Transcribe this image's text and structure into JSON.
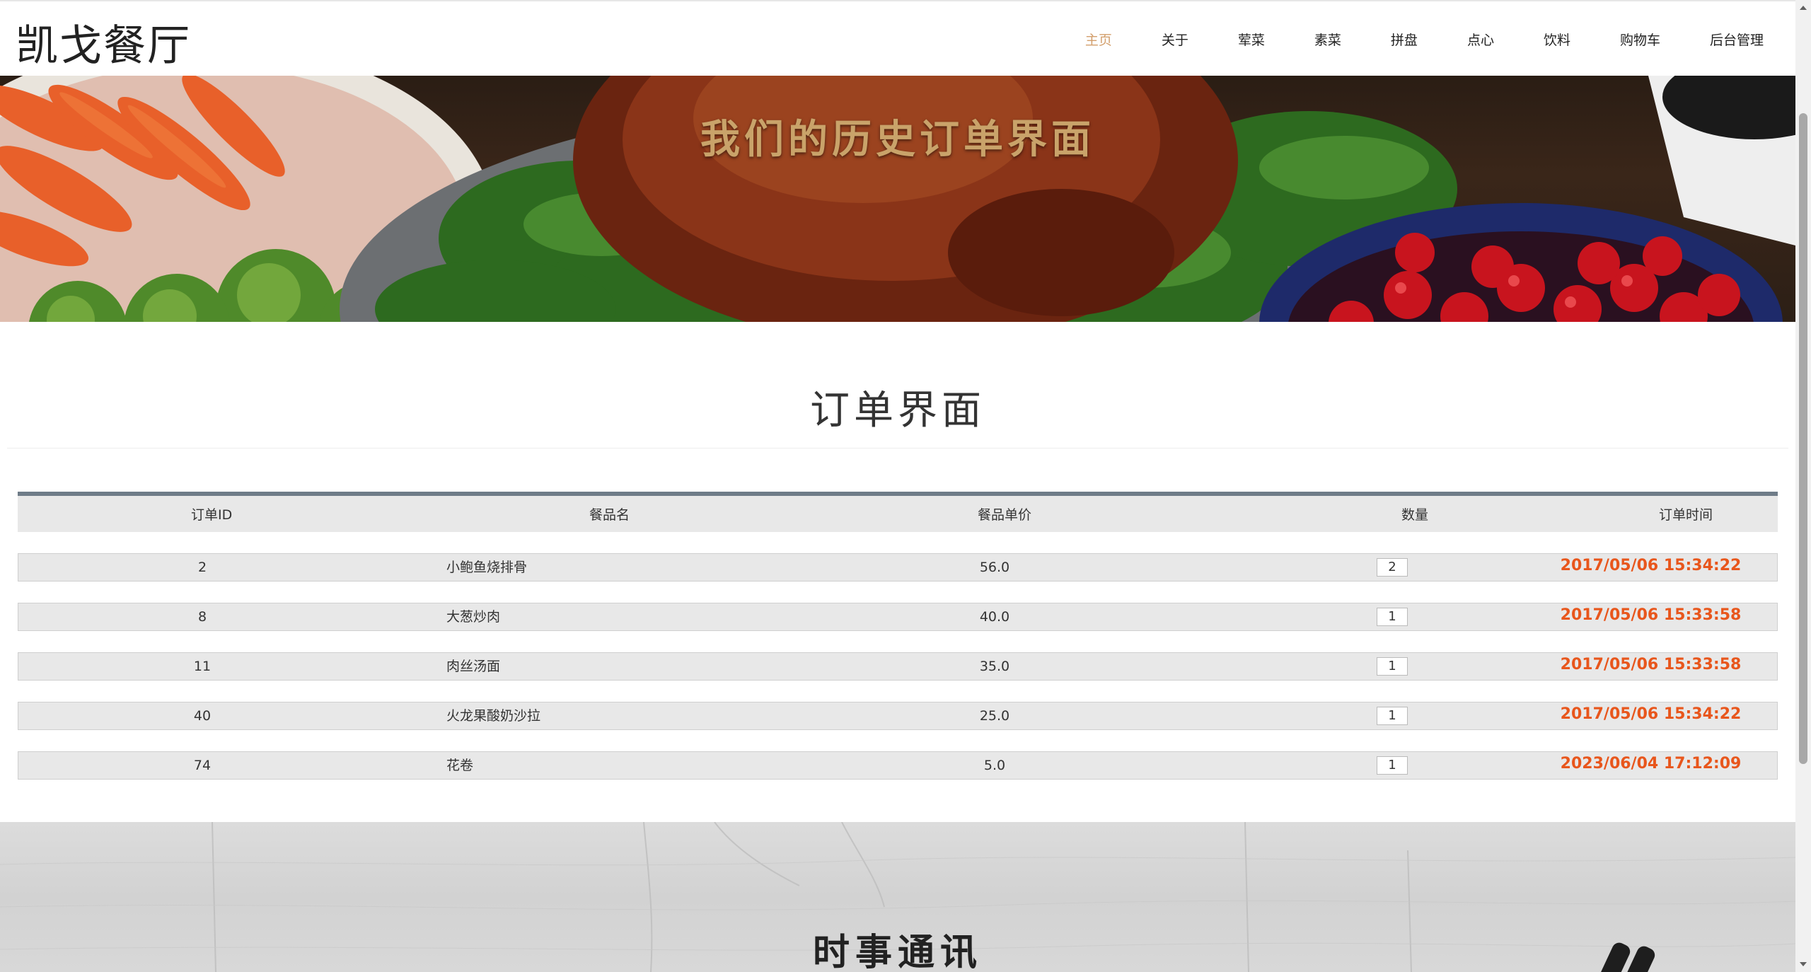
{
  "header": {
    "logo": "凯戈餐厅",
    "nav": [
      {
        "label": "主页",
        "active": true
      },
      {
        "label": "关于",
        "active": false
      },
      {
        "label": "荤菜",
        "active": false
      },
      {
        "label": "素菜",
        "active": false
      },
      {
        "label": "拼盘",
        "active": false
      },
      {
        "label": "点心",
        "active": false
      },
      {
        "label": "饮料",
        "active": false
      },
      {
        "label": "购物车",
        "active": false
      },
      {
        "label": "后台管理",
        "active": false
      }
    ]
  },
  "banner": {
    "title": "我们的历史订单界面"
  },
  "section": {
    "title": "订单界面"
  },
  "table": {
    "headers": [
      "订单ID",
      "餐品名",
      "餐品单价",
      "数量",
      "订单时间"
    ],
    "rows": [
      {
        "id": "2",
        "name": "小鲍鱼烧排骨",
        "price": "56.0",
        "qty": "2",
        "time": "2017/05/06 15:34:22"
      },
      {
        "id": "8",
        "name": "大葱炒肉",
        "price": "40.0",
        "qty": "1",
        "time": "2017/05/06 15:33:58"
      },
      {
        "id": "11",
        "name": "肉丝汤面",
        "price": "35.0",
        "qty": "1",
        "time": "2017/05/06 15:33:58"
      },
      {
        "id": "40",
        "name": "火龙果酸奶沙拉",
        "price": "25.0",
        "qty": "1",
        "time": "2017/05/06 15:34:22"
      },
      {
        "id": "74",
        "name": "花卷",
        "price": "5.0",
        "qty": "1",
        "time": "2023/06/04 17:12:09"
      }
    ]
  },
  "news": {
    "title": "时事通讯"
  },
  "colors": {
    "accent": "#d39f6c",
    "time_text": "#e8561c",
    "table_border_top": "#6f7c88",
    "row_bg": "#e8e8e8"
  }
}
